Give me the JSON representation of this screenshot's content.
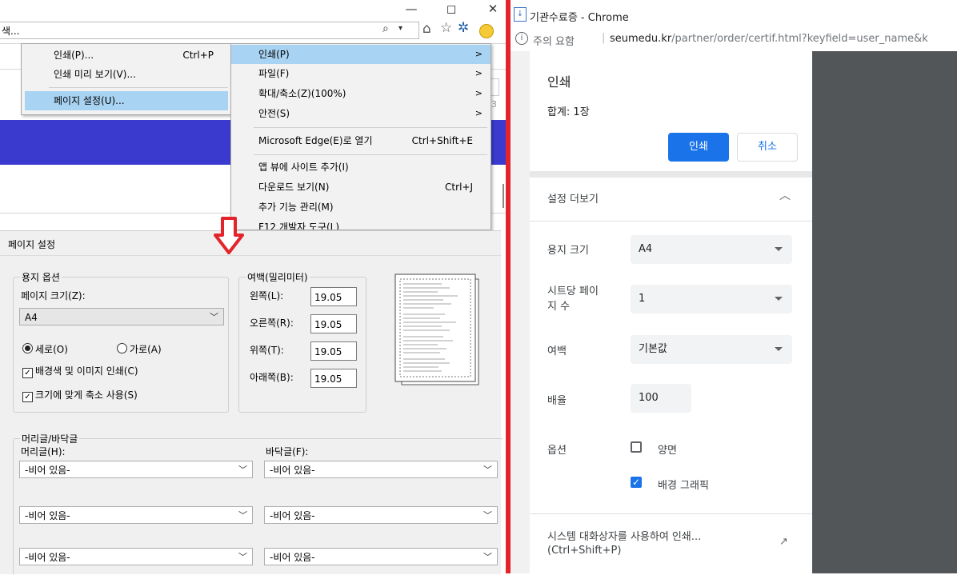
{
  "ie": {
    "address_text": "색...",
    "window_buttons": {
      "minimize": "—",
      "restore": "◻",
      "close": "✕"
    },
    "menu_left": [
      {
        "label": "인쇄(P)...",
        "accel": "Ctrl+P"
      },
      {
        "label": "인쇄 미리 보기(V)...",
        "accel": ""
      },
      {
        "label": "페이지 설정(U)...",
        "accel": ""
      }
    ],
    "menu_right": [
      {
        "label": "인쇄(P)",
        "accel": "",
        "arrow": ">"
      },
      {
        "label": "파일(F)",
        "accel": "",
        "arrow": ">"
      },
      {
        "label": "확대/축소(Z)(100%)",
        "accel": "",
        "arrow": ">"
      },
      {
        "label": "안전(S)",
        "accel": "",
        "arrow": ">"
      },
      {
        "label": "Microsoft Edge(E)로 열기",
        "accel": "Ctrl+Shift+E",
        "arrow": ""
      },
      {
        "label": "앱 뷰에 사이트 추가(I)",
        "accel": "",
        "arrow": ""
      },
      {
        "label": "다운로드 보기(N)",
        "accel": "Ctrl+J",
        "arrow": ""
      },
      {
        "label": "추가 기능 관리(M)",
        "accel": "",
        "arrow": ""
      },
      {
        "label": "F12 개발자 도구(L)",
        "accel": "",
        "arrow": ""
      }
    ],
    "partial_number": "3"
  },
  "page_setup": {
    "title": "페이지 설정",
    "paper_group": "용지 옵션",
    "page_size_label": "페이지 크기(Z):",
    "page_size_value": "A4",
    "portrait": "세로(O)",
    "landscape": "가로(A)",
    "print_bg": "배경색 및 이미지 인쇄(C)",
    "shrink_fit": "크기에 맞게 축소 사용(S)",
    "margin_group": "여백(밀리미터)",
    "margins": [
      {
        "label": "왼쪽(L):",
        "value": "19.05"
      },
      {
        "label": "오른쪽(R):",
        "value": "19.05"
      },
      {
        "label": "위쪽(T):",
        "value": "19.05"
      },
      {
        "label": "아래쪽(B):",
        "value": "19.05"
      }
    ],
    "hf_group": "머리글/바닥글",
    "header_label": "머리글(H):",
    "footer_label": "바닥글(F):",
    "empty_option": "-비어 있음-"
  },
  "chrome": {
    "tab_title": "기관수료증 - Chrome",
    "security_label": "주의 요함",
    "url_domain": "seumedu.kr",
    "url_path": "/partner/order/certif.html?keyfield=user_name&k",
    "print_title": "인쇄",
    "total": "합계: 1장",
    "print_button": "인쇄",
    "cancel_button": "취소",
    "more_settings": "설정 더보기",
    "paper_size_label": "용지 크기",
    "paper_size_value": "A4",
    "pages_per_sheet_label_1": "시트당 페이",
    "pages_per_sheet_label_2": "지 수",
    "pages_per_sheet_value": "1",
    "margins_label": "여백",
    "margins_value": "기본값",
    "scale_label": "배율",
    "scale_value": "100",
    "options_label": "옵션",
    "duplex_label": "양면",
    "bg_graphics_label": "배경 그래픽",
    "system_dialog_1": "시스템 대화상자를 사용하여 인쇄...",
    "system_dialog_2": "(Ctrl+Shift+P)"
  },
  "colors": {
    "accent_red": "#e3242b",
    "chrome_blue": "#1a73e8",
    "ie_band": "#3a3acf",
    "menu_highlight": "#a9d3f3"
  }
}
